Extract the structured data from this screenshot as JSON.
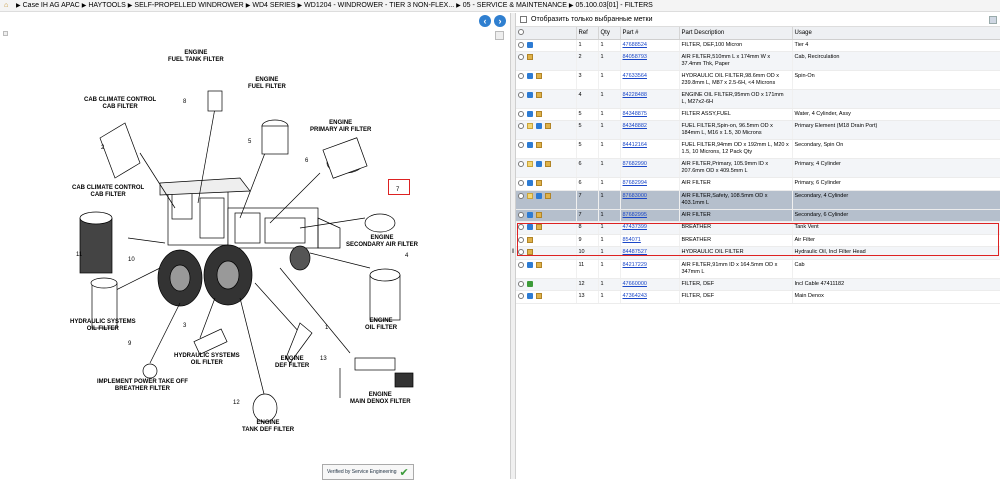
{
  "breadcrumb": {
    "items": [
      "Case IH AG APAC",
      "HAYTOOLS",
      "SELF-PROPELLED WINDROWER",
      "WD4 SERIES",
      "WD1204 - WINDROWER - TIER 3 NON-FLEX...",
      "05 - SERVICE & MAINTENANCE",
      "05.100.03[01] - FILTERS"
    ]
  },
  "diagram": {
    "labels": {
      "fuel_tank": "ENGINE\nFUEL TANK FILTER",
      "fuel": "ENGINE\nFUEL FILTER",
      "cab_climate_1": "CAB CLIMATE CONTROL\nCAB FILTER",
      "primary_air": "ENGINE\nPRIMARY AIR FILTER",
      "cab_climate_2": "CAB CLIMATE CONTROL\nCAB FILTER",
      "secondary_air": "ENGINE\nSECONDARY AIR FILTER",
      "oil": "ENGINE\nOIL FILTER",
      "hyd_sys_1": "HYDRAULIC SYSTEMS\nOIL FILTER",
      "hyd_sys_2": "HYDRAULIC SYSTEMS\nOIL FILTER",
      "def": "ENGINE\nDEF FILTER",
      "pto": "IMPLEMENT POWER TAKE OFF\nBREATHER FILTER",
      "main_denox": "ENGINE\nMAIN DENOX FILTER",
      "tank_def": "ENGINE\nTANK DEF FILTER"
    },
    "numbers": {
      "n8": "8",
      "n5": "5",
      "n2": "2",
      "n6": "6",
      "n7": "7",
      "n11": "11",
      "n10": "10",
      "n4": "4",
      "n3": "3",
      "n1": "1",
      "n9": "9",
      "n13": "13",
      "n12": "12"
    },
    "verified": "Verified by Service Engineering"
  },
  "filter_label": "Отобразить только выбранные метки",
  "table": {
    "headers": {
      "ref": "Ref",
      "qty": "Qty",
      "part": "Part #",
      "desc": "Part Description",
      "usage": "Usage"
    },
    "rows": [
      {
        "ref": "1",
        "qty": "1",
        "part": "47688524",
        "desc": "FILTER, DEF,100 Micron",
        "usage": "Tier 4"
      },
      {
        "ref": "2",
        "qty": "1",
        "part": "84058793",
        "desc": "AIR FILTER,510mm L x 174mm W x 37.4mm Thk, Paper",
        "usage": "Cab, Recirculation"
      },
      {
        "ref": "3",
        "qty": "1",
        "part": "47633564",
        "desc": "HYDRAULIC OIL FILTER,98.6mm OD x 239.8mm L, M87 x 2.5-6H, <4 Microns",
        "usage": "Spin-On"
      },
      {
        "ref": "4",
        "qty": "1",
        "part": "84228488",
        "desc": "ENGINE OIL FILTER,95mm OD x 171mm L, M27x2-6H",
        "usage": ""
      },
      {
        "ref": "5",
        "qty": "1",
        "part": "84348875",
        "desc": "FILTER ASSY,FUEL",
        "usage": "Water, 4 Cylinder, Assy"
      },
      {
        "ref": "5",
        "qty": "1",
        "part": "84348882",
        "desc": "FUEL FILTER,Spin-on, 96.5mm OD x 184mm L, M16 x 1.5, 30 Microns",
        "usage": "Primary Element (M18 Drain Port)"
      },
      {
        "ref": "5",
        "qty": "1",
        "part": "84412164",
        "desc": "FUEL FILTER,94mm OD x 192mm L, M20 x 1.5, 10 Microns, 12 Pack Qty",
        "usage": "Secondary, Spin On"
      },
      {
        "ref": "6",
        "qty": "1",
        "part": "87682990",
        "desc": "AIR FILTER,Primary, 105.9mm ID x 207.6mm OD x 409.5mm L",
        "usage": "Primary, 4 Cylinder"
      },
      {
        "ref": "6",
        "qty": "1",
        "part": "87682994",
        "desc": "AIR FILTER",
        "usage": "Primary, 6 Cylinder"
      },
      {
        "ref": "7",
        "qty": "1",
        "part": "87683000",
        "desc": "AIR FILTER,Safety, 108.5mm OD x 403.1mm L",
        "usage": "Secondary, 4 Cylinder"
      },
      {
        "ref": "7",
        "qty": "1",
        "part": "87682995",
        "desc": "AIR FILTER",
        "usage": "Secondary, 6 Cylinder"
      },
      {
        "ref": "8",
        "qty": "1",
        "part": "47437399",
        "desc": "BREATHER",
        "usage": "Tank Vent"
      },
      {
        "ref": "9",
        "qty": "1",
        "part": "854071",
        "desc": "BREATHER",
        "usage": "Air Filter"
      },
      {
        "ref": "10",
        "qty": "1",
        "part": "84487527",
        "desc": "HYDRAULIC OIL FILTER",
        "usage": "Hydraulic Oil, Incl Filter Head"
      },
      {
        "ref": "11",
        "qty": "1",
        "part": "84217229",
        "desc": "AIR FILTER,91mm ID x 164.5mm OD x 347mm L",
        "usage": "Cab"
      },
      {
        "ref": "12",
        "qty": "1",
        "part": "47660000",
        "desc": "FILTER, DEF",
        "usage": "Incl Cable 47411182"
      },
      {
        "ref": "13",
        "qty": "1",
        "part": "47364243",
        "desc": "FILTER, DEF",
        "usage": "Main Denox"
      }
    ]
  }
}
